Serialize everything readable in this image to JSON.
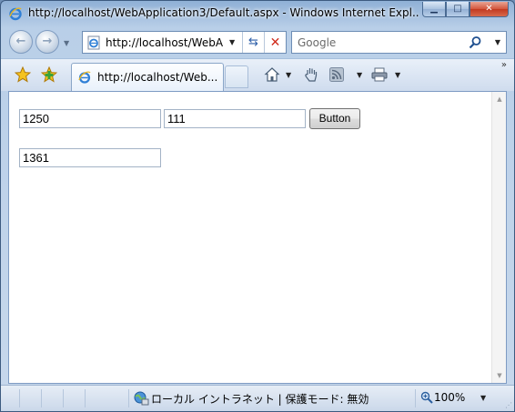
{
  "window": {
    "title": "http://localhost/WebApplication3/Default.aspx - Windows Internet Expl..."
  },
  "navigation": {
    "address_text": "http://localhost/WebA",
    "search_placeholder": "Google"
  },
  "tab": {
    "label": "http://localhost/Web..."
  },
  "form": {
    "textbox1_value": "1250",
    "textbox2_value": "111",
    "button_label": "Button",
    "result_value": "1361"
  },
  "status": {
    "zone_text": "ローカル イントラネット | 保護モード: 無効",
    "zoom_text": "100%"
  },
  "colors": {
    "frame": "#b9cfe8",
    "close_button": "#c23a20",
    "page_background": "#ffffff"
  }
}
